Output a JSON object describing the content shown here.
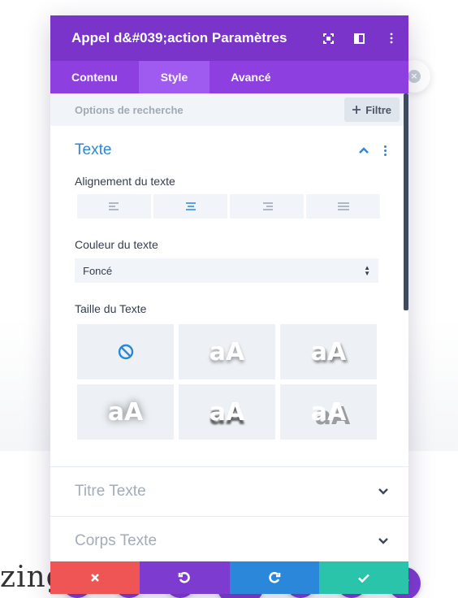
{
  "modal": {
    "title": "Appel d&#039;action Paramètres",
    "header_icons": [
      "expand-icon",
      "split-view-icon",
      "more-vertical-icon"
    ],
    "tabs": [
      {
        "label": "Contenu",
        "active": false
      },
      {
        "label": "Style",
        "active": true
      },
      {
        "label": "Avancé",
        "active": false
      }
    ],
    "search": {
      "placeholder": "Options de recherche",
      "filter_label": "Filtre"
    },
    "text_section": {
      "title": "Texte",
      "alignment_label": "Alignement du texte",
      "alignment_options": [
        "left",
        "center",
        "right",
        "justify"
      ],
      "alignment_selected": "center",
      "color_label": "Couleur du texte",
      "color_value": "Foncé",
      "size_label": "Taille du Texte",
      "size_presets": [
        "none",
        "aA",
        "aA",
        "aA",
        "aA",
        "aA"
      ]
    },
    "collapsed_sections": [
      {
        "title": "Titre Texte"
      },
      {
        "title": "Corps Texte"
      }
    ],
    "footer": {
      "buttons": [
        "discard",
        "undo",
        "redo",
        "save"
      ],
      "colors": {
        "discard": "#ef5555",
        "undo": "#7e3bd0",
        "redo": "#2b87da",
        "save": "#29c4a9"
      }
    }
  },
  "background": {
    "partial_text": "zing notice"
  },
  "colors": {
    "header": "#7a34c9",
    "tabs": "#8d3fe0",
    "accent": "#2b87da"
  }
}
